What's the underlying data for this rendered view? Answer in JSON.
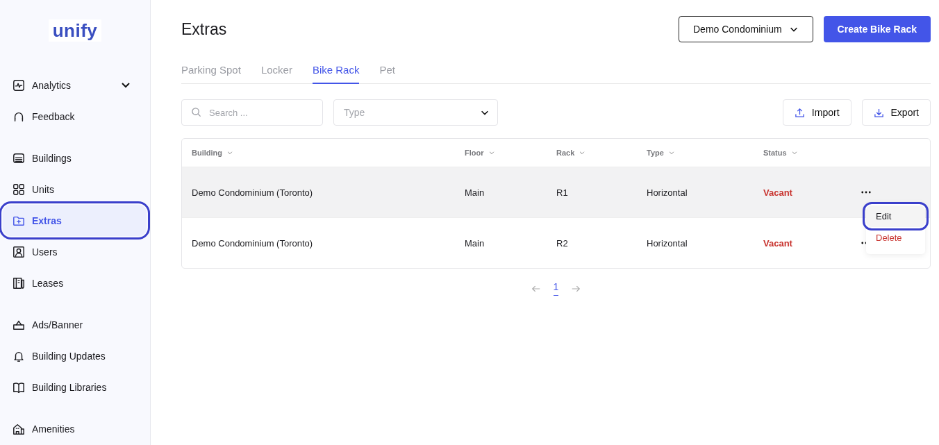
{
  "logo": "unify",
  "sidebar": {
    "groups": [
      [
        {
          "label": "Analytics",
          "selected": false,
          "expandable": true,
          "highlighted": false
        },
        {
          "label": "Feedback",
          "selected": false,
          "expandable": false,
          "highlighted": false
        }
      ],
      [
        {
          "label": "Buildings",
          "selected": false,
          "expandable": false,
          "highlighted": false
        },
        {
          "label": "Units",
          "selected": false,
          "expandable": false,
          "highlighted": false
        },
        {
          "label": "Extras",
          "selected": true,
          "expandable": false,
          "highlighted": true
        },
        {
          "label": "Users",
          "selected": false,
          "expandable": false,
          "highlighted": false
        },
        {
          "label": "Leases",
          "selected": false,
          "expandable": false,
          "highlighted": false
        }
      ],
      [
        {
          "label": "Ads/Banner",
          "selected": false,
          "expandable": false,
          "highlighted": false
        },
        {
          "label": "Building Updates",
          "selected": false,
          "expandable": false,
          "highlighted": false
        },
        {
          "label": "Building Libraries",
          "selected": false,
          "expandable": false,
          "highlighted": false
        }
      ],
      [
        {
          "label": "Amenities",
          "selected": false,
          "expandable": false,
          "highlighted": false
        }
      ]
    ]
  },
  "page_title": "Extras",
  "building_select": "Demo Condominium",
  "create_button": "Create Bike Rack",
  "tabs": [
    {
      "label": "Parking Spot",
      "selected": false
    },
    {
      "label": "Locker",
      "selected": false
    },
    {
      "label": "Bike Rack",
      "selected": true
    },
    {
      "label": "Pet",
      "selected": false
    }
  ],
  "search": {
    "placeholder": "Search ..."
  },
  "type_filter": {
    "placeholder": "Type"
  },
  "import_button": "Import",
  "export_button": "Export",
  "table": {
    "columns": [
      "Building",
      "Floor",
      "Rack",
      "Type",
      "Status"
    ],
    "rows": [
      {
        "cells": [
          "Demo Condominium (Toronto)",
          "Main",
          "R1",
          "Horizontal"
        ],
        "status": "Vacant",
        "hovered": true
      },
      {
        "cells": [
          "Demo Condominium (Toronto)",
          "Main",
          "R2",
          "Horizontal"
        ],
        "status": "Vacant",
        "hovered": false
      }
    ]
  },
  "row_menu": {
    "items": [
      {
        "label": "Edit",
        "kind": "normal",
        "highlighted": true
      },
      {
        "label": "Delete",
        "kind": "danger",
        "highlighted": false
      }
    ]
  },
  "pagination": {
    "pages": [
      {
        "label": "1",
        "selected": true
      }
    ]
  }
}
